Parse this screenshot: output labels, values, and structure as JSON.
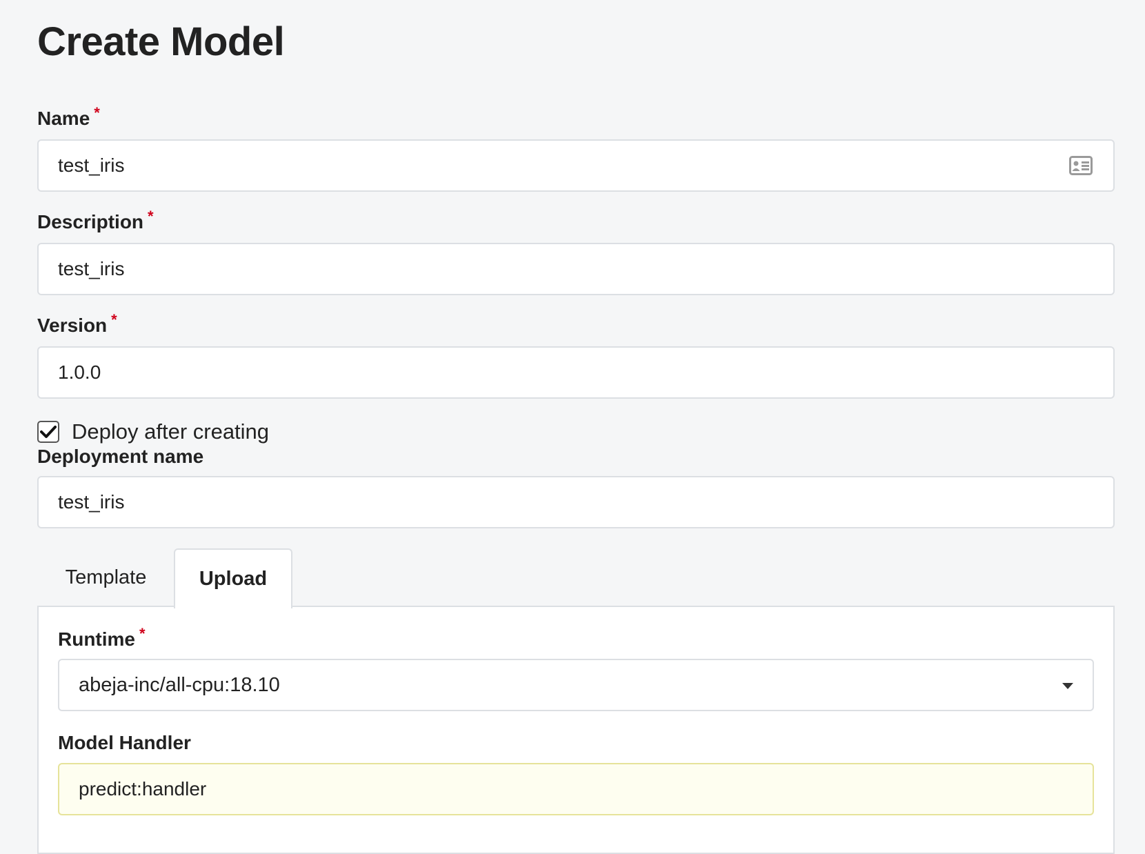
{
  "page": {
    "title": "Create Model"
  },
  "form": {
    "name": {
      "label": "Name",
      "required_mark": "*",
      "value": "test_iris",
      "icon": "contact-card-icon"
    },
    "description": {
      "label": "Description",
      "required_mark": "*",
      "value": "test_iris"
    },
    "version": {
      "label": "Version",
      "required_mark": "*",
      "value": "1.0.0"
    },
    "deploy": {
      "label": "Deploy after creating",
      "checked": true
    },
    "deployment_name": {
      "label": "Deployment name",
      "value": "test_iris"
    }
  },
  "tabs": [
    {
      "label": "Template",
      "active": false
    },
    {
      "label": "Upload",
      "active": true
    }
  ],
  "upload_panel": {
    "runtime": {
      "label": "Runtime",
      "required_mark": "*",
      "selected": "abeja-inc/all-cpu:18.10"
    },
    "model_handler": {
      "label": "Model Handler",
      "value": "predict:handler"
    }
  },
  "colors": {
    "background": "#f5f6f7",
    "required": "#d0021b",
    "border": "#dcdfe3",
    "highlight_field": "#fefef0"
  }
}
